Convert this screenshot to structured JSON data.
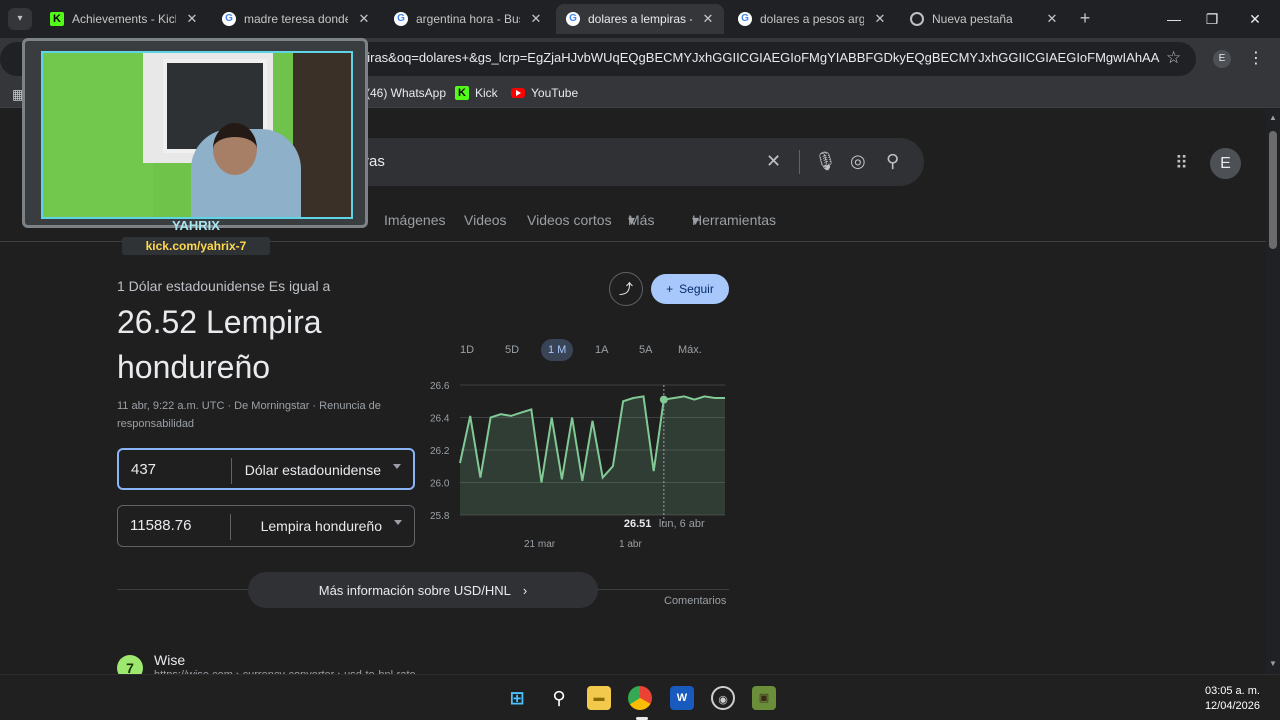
{
  "tabs": [
    {
      "title": "Achievements - Kick",
      "favicon": "kick-icon",
      "active": false
    },
    {
      "title": "madre teresa donde",
      "favicon": "google-icon",
      "active": false
    },
    {
      "title": "argentina hora - Bus",
      "favicon": "google-icon",
      "active": false
    },
    {
      "title": "dolares a lempiras -",
      "favicon": "google-icon",
      "active": true
    },
    {
      "title": "dolares a pesos arge",
      "favicon": "google-icon",
      "active": false
    },
    {
      "title": "Nueva pestaña",
      "favicon": "chrome-icon",
      "active": false
    }
  ],
  "address_bar": {
    "url_tail": "piras&oq=dolares+&gs_lcrp=EgZjaHJvbWUqEQgBECMYJxhGGIICGIAEGIoFMgYIABBFGDkyEQgBECMYJxhGGIICGIAEGIoFMgwIAhAAGE..."
  },
  "profile_initial": "E",
  "bookmarks": [
    {
      "label": "(46) WhatsApp"
    },
    {
      "label": "Kick"
    },
    {
      "label": "YouTube"
    }
  ],
  "search": {
    "query_visible": "ras"
  },
  "search_tabs": [
    "Imágenes",
    "Videos",
    "Videos cortos",
    "Más",
    "Herramientas"
  ],
  "converter": {
    "equals_label": "1 Dólar estadounidense Es igual a",
    "result": "26.52 Lempira hondureño",
    "timestamp": "11 abr, 9:22 a.m. UTC · De Morningstar · Renuncia de responsabilidad",
    "from_amount": "437",
    "from_currency": "Dólar estadounidense",
    "to_amount": "11588.76",
    "to_currency": "Lempira hondureño",
    "follow_label": "Seguir",
    "ranges": [
      "1D",
      "5D",
      "1 M",
      "1A",
      "5A",
      "Máx."
    ],
    "selected_range": "1 M",
    "more_info": "Más información sobre USD/HNL",
    "comments": "Comentarios"
  },
  "chart_data": {
    "type": "area",
    "y_ticks": [
      "26.6",
      "26.4",
      "26.2",
      "26.0",
      "25.8"
    ],
    "x_ticks": [
      "21 mar",
      "1 abr"
    ],
    "ylim": [
      25.8,
      26.6
    ],
    "values": [
      26.12,
      26.41,
      26.03,
      26.4,
      26.42,
      26.41,
      26.43,
      26.45,
      26.0,
      26.4,
      26.02,
      26.4,
      26.01,
      26.38,
      26.03,
      26.1,
      26.5,
      26.52,
      26.53,
      26.07,
      26.51,
      26.52,
      26.53,
      26.51,
      26.53,
      26.52,
      26.52
    ],
    "tooltip_value": "26.51",
    "tooltip_date": "lun, 6 abr",
    "line_color": "#81c995",
    "grid": true
  },
  "result_item": {
    "name": "Wise",
    "url": "https://wise.com › currency-converter › usd-to-hnl-rate"
  },
  "webcam": {
    "name": "YAHRIX",
    "link": "kick.com/yahrix-7"
  },
  "taskbar": {
    "time": "03:05 a. m.",
    "date": "12/04/2026"
  }
}
